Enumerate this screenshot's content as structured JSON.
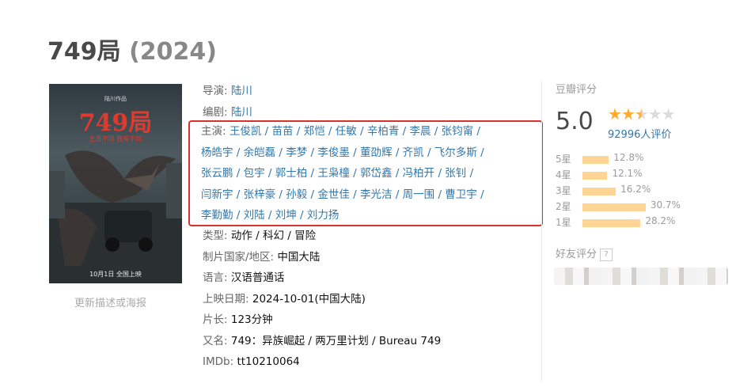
{
  "title": {
    "name": "749局",
    "year": "(2024)"
  },
  "poster": {
    "tagline_top": "陆川作品",
    "big_title": "749局",
    "slogan": "生而不同 我有不同",
    "date": "10月1日 全国上映"
  },
  "update_link": "更新描述或海报",
  "info": {
    "director": {
      "label": "导演:",
      "value": "陆川"
    },
    "writer": {
      "label": "编剧:",
      "value": "陆川"
    },
    "cast_label": "主演:",
    "cast_lines": [
      "王俊凯 / 苗苗 / 郑恺 / 任敏 / 辛柏青 / 李晨 / 张钧甯 /",
      "杨皓宇 / 余皑磊 / 李梦 / 李俊墨 / 董劭辉 / 齐凯 / 飞尔多斯 /",
      "张云鹏 / 包宇 / 郭士柏 / 王枭橦 / 郭岱鑫 / 冯柏开 / 张钊 /",
      "闫新宇 / 张梓豪 / 孙毅 / 金世佳 / 李光洁 / 周一围 / 曹卫宇 /",
      "李勤勤 / 刘陆 / 刘坤 / 刘力扬"
    ],
    "genre": {
      "label": "类型:",
      "value": "动作 / 科幻 / 冒险"
    },
    "country": {
      "label": "制片国家/地区:",
      "value": "中国大陆"
    },
    "language": {
      "label": "语言:",
      "value": "汉语普通话"
    },
    "release": {
      "label": "上映日期:",
      "value": "2024-10-01(中国大陆)"
    },
    "runtime": {
      "label": "片长:",
      "value": "123分钟"
    },
    "aka": {
      "label": "又名:",
      "value": "749：异族崛起 / 两万里计划 / Bureau 749"
    },
    "imdb": {
      "label": "IMDb:",
      "value": "tt10210064"
    }
  },
  "rating": {
    "header": "豆瓣评分",
    "score": "5.0",
    "stars": 2.5,
    "votes": "92996人评价",
    "distribution": [
      {
        "label": "5星",
        "pct": "12.8%",
        "value": 12.8
      },
      {
        "label": "4星",
        "pct": "12.1%",
        "value": 12.1
      },
      {
        "label": "3星",
        "pct": "16.2%",
        "value": 16.2
      },
      {
        "label": "2星",
        "pct": "30.7%",
        "value": 30.7
      },
      {
        "label": "1星",
        "pct": "28.2%",
        "value": 28.2
      }
    ]
  },
  "friend_rating": {
    "label": "好友评分",
    "help": "?"
  },
  "colors": {
    "link": "#3377aa",
    "highlight_box": "#d9312b",
    "star": "#ffac2d",
    "bar": "#ffd596"
  }
}
